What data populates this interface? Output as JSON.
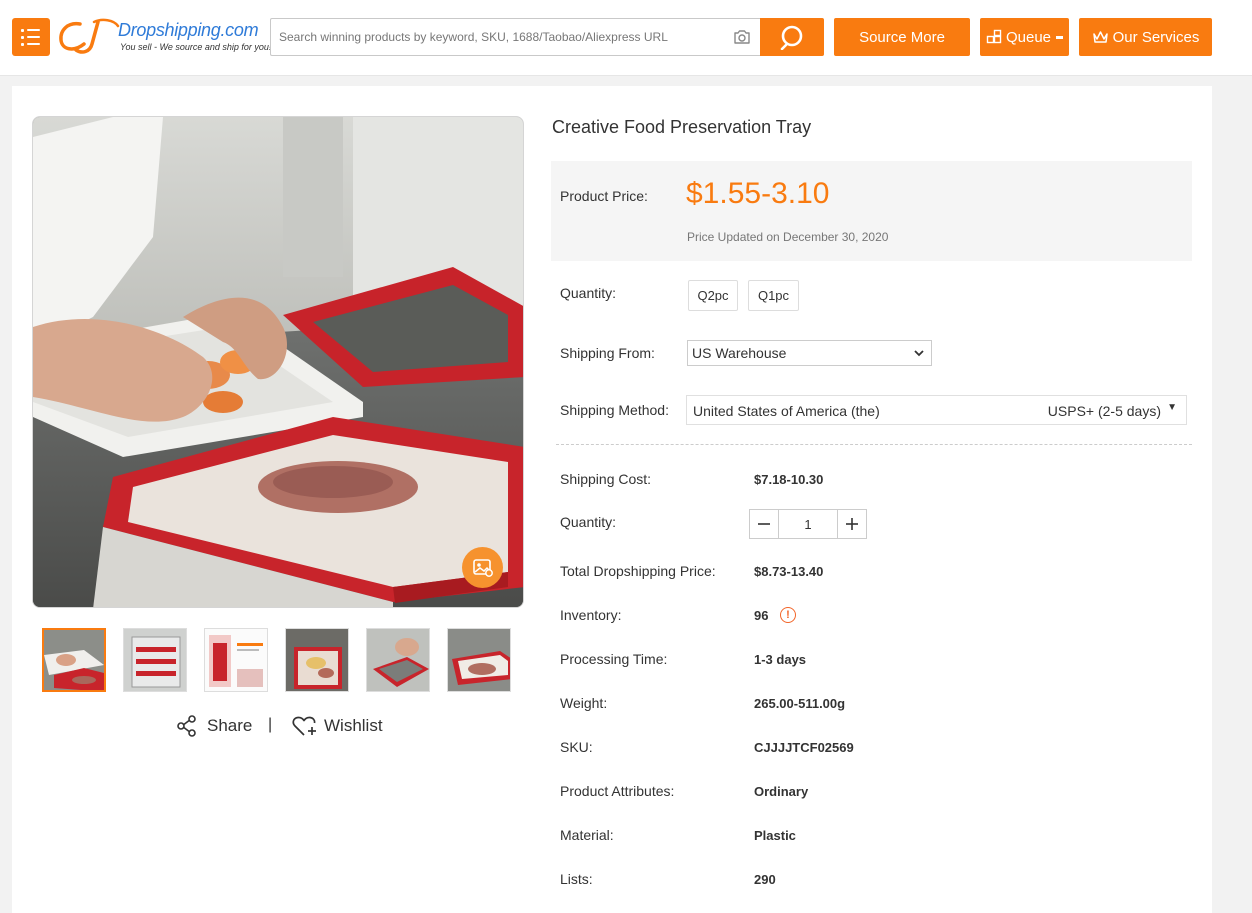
{
  "header": {
    "logo": {
      "brand": "Dropshipping.com",
      "tagline": "You sell - We source and ship for you!"
    },
    "search": {
      "placeholder": "Search winning products by keyword, SKU, 1688/Taobao/Aliexpress URL",
      "value": ""
    },
    "buttons": {
      "source_more": "Source More",
      "queue": "Queue",
      "our_services": "Our Services"
    },
    "accent_color": "#f97b10"
  },
  "product": {
    "title": "Creative Food Preservation Tray",
    "price_label": "Product Price:",
    "price": "$1.55-3.10",
    "price_updated": "Price Updated on December 30, 2020",
    "quantity_label": "Quantity:",
    "quantity_options": [
      "Q2pc",
      "Q1pc"
    ],
    "shipping_from_label": "Shipping From:",
    "shipping_from": "US Warehouse",
    "shipping_method_label": "Shipping Method:",
    "shipping_country": "United States of America (the)",
    "shipping_method": "USPS+ (2-5 days)",
    "details": {
      "shipping_cost_label": "Shipping Cost:",
      "shipping_cost": "$7.18-10.30",
      "quantity_label": "Quantity:",
      "quantity": "1",
      "total_label": "Total Dropshipping Price:",
      "total": "$8.73-13.40",
      "inventory_label": "Inventory:",
      "inventory": "96",
      "processing_label": "Processing Time:",
      "processing": "1-3 days",
      "weight_label": "Weight:",
      "weight": "265.00-511.00g",
      "sku_label": "SKU:",
      "sku": "CJJJJTCF02569",
      "attributes_label": "Product Attributes:",
      "attributes": "Ordinary",
      "material_label": "Material:",
      "material": "Plastic",
      "lists_label": "Lists:",
      "lists": "290"
    }
  },
  "gallery": {
    "thumbnail_count": 6,
    "active_index": 0,
    "share_label": "Share",
    "separator": "|",
    "wishlist_label": "Wishlist"
  },
  "icons": {
    "menu": "menu-icon",
    "camera": "camera-icon",
    "search": "search-icon",
    "queue": "grid-icon",
    "services": "crown-icon",
    "share": "share-icon",
    "wishlist": "heart-plus-icon",
    "inventory_info": "warning-icon",
    "image_search": "image-search-icon"
  }
}
